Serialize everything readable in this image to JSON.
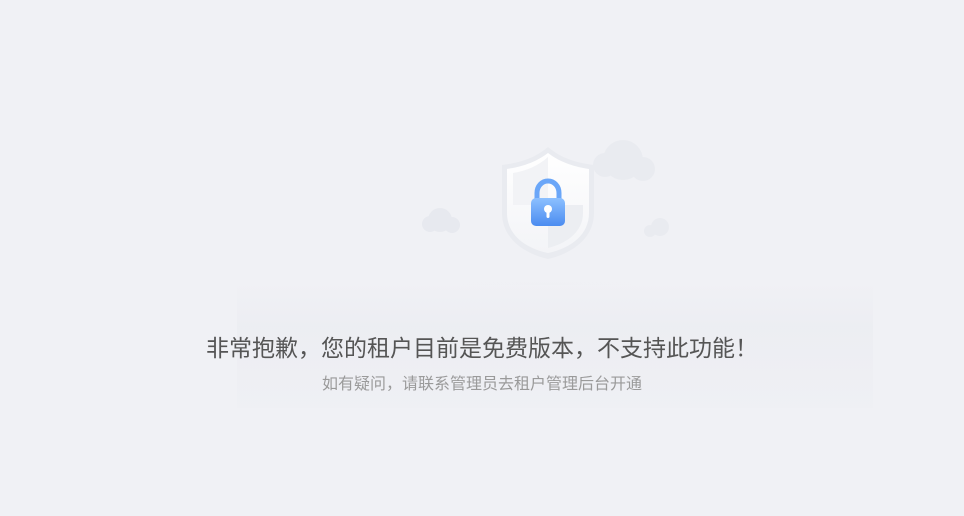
{
  "message": {
    "title": "非常抱歉，您的租户目前是免费版本，不支持此功能！",
    "subtitle": "如有疑问，请联系管理员去租户管理后台开通"
  },
  "icons": {
    "illustration": "shield-lock-icon"
  },
  "colors": {
    "background": "#f0f1f5",
    "title": "#555555",
    "subtitle": "#9a9a9a",
    "lock": "#5b9bf5"
  }
}
